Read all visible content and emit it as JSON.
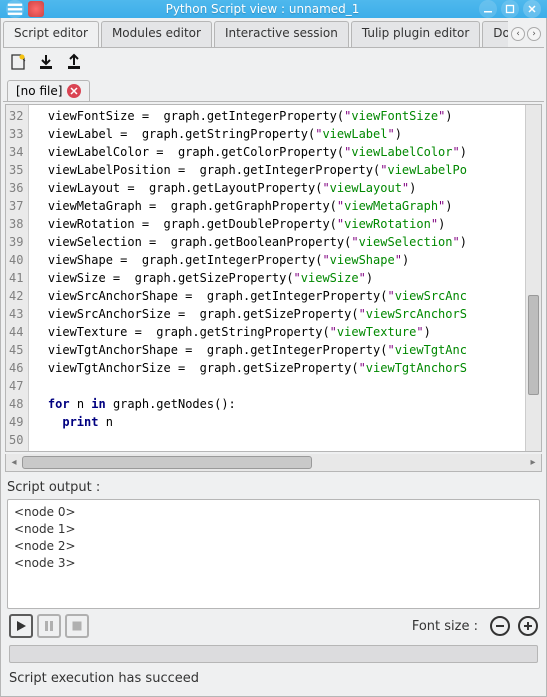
{
  "window": {
    "title": "Python Script view : unnamed_1"
  },
  "tabs": {
    "items": [
      "Script editor",
      "Modules editor",
      "Interactive session",
      "Tulip plugin editor",
      "Docum"
    ],
    "active_index": 0
  },
  "file_tab": {
    "label": "[no file]"
  },
  "code": {
    "first_line": 32,
    "lines": [
      {
        "indent": 1,
        "var": "viewFontSize",
        "method": "getIntegerProperty",
        "arg": "viewFontSize",
        "close": true
      },
      {
        "indent": 1,
        "var": "viewLabel",
        "method": "getStringProperty",
        "arg": "viewLabel",
        "close": true
      },
      {
        "indent": 1,
        "var": "viewLabelColor",
        "method": "getColorProperty",
        "arg": "viewLabelColor",
        "close": false
      },
      {
        "indent": 1,
        "var": "viewLabelPosition",
        "method": "getIntegerProperty",
        "arg": "viewLabelPo",
        "close": false,
        "noquote_end": true
      },
      {
        "indent": 1,
        "var": "viewLayout",
        "method": "getLayoutProperty",
        "arg": "viewLayout",
        "close": true
      },
      {
        "indent": 1,
        "var": "viewMetaGraph",
        "method": "getGraphProperty",
        "arg": "viewMetaGraph",
        "close": true
      },
      {
        "indent": 1,
        "var": "viewRotation",
        "method": "getDoubleProperty",
        "arg": "viewRotation",
        "close": true
      },
      {
        "indent": 1,
        "var": "viewSelection",
        "method": "getBooleanProperty",
        "arg": "viewSelection",
        "close": false
      },
      {
        "indent": 1,
        "var": "viewShape",
        "method": "getIntegerProperty",
        "arg": "viewShape",
        "close": true
      },
      {
        "indent": 1,
        "var": "viewSize",
        "method": "getSizeProperty",
        "arg": "viewSize",
        "close": true
      },
      {
        "indent": 1,
        "var": "viewSrcAnchorShape",
        "method": "getIntegerProperty",
        "arg": "viewSrcAnc",
        "close": false,
        "noquote_end": true
      },
      {
        "indent": 1,
        "var": "viewSrcAnchorSize",
        "method": "getSizeProperty",
        "arg": "viewSrcAnchorS",
        "close": false,
        "noquote_end": true
      },
      {
        "indent": 1,
        "var": "viewTexture",
        "method": "getStringProperty",
        "arg": "viewTexture",
        "close": true
      },
      {
        "indent": 1,
        "var": "viewTgtAnchorShape",
        "method": "getIntegerProperty",
        "arg": "viewTgtAnc",
        "close": false,
        "noquote_end": true
      },
      {
        "indent": 1,
        "var": "viewTgtAnchorSize",
        "method": "getSizeProperty",
        "arg": "viewTgtAnchorS",
        "close": false,
        "noquote_end": true
      },
      {
        "blank": true
      },
      {
        "for_line": true,
        "kw1": "for",
        "mid": " n ",
        "kw2": "in",
        "tail": " graph.getNodes():"
      },
      {
        "print_line": true,
        "kw": "print",
        "tail": " n"
      },
      {
        "blank": true
      }
    ]
  },
  "output": {
    "label": "Script output :",
    "lines": [
      "<node 0>",
      "<node 1>",
      "<node 2>",
      "<node 3>"
    ]
  },
  "controls": {
    "font_label": "Font size :"
  },
  "status": {
    "text": "Script execution has succeed"
  }
}
